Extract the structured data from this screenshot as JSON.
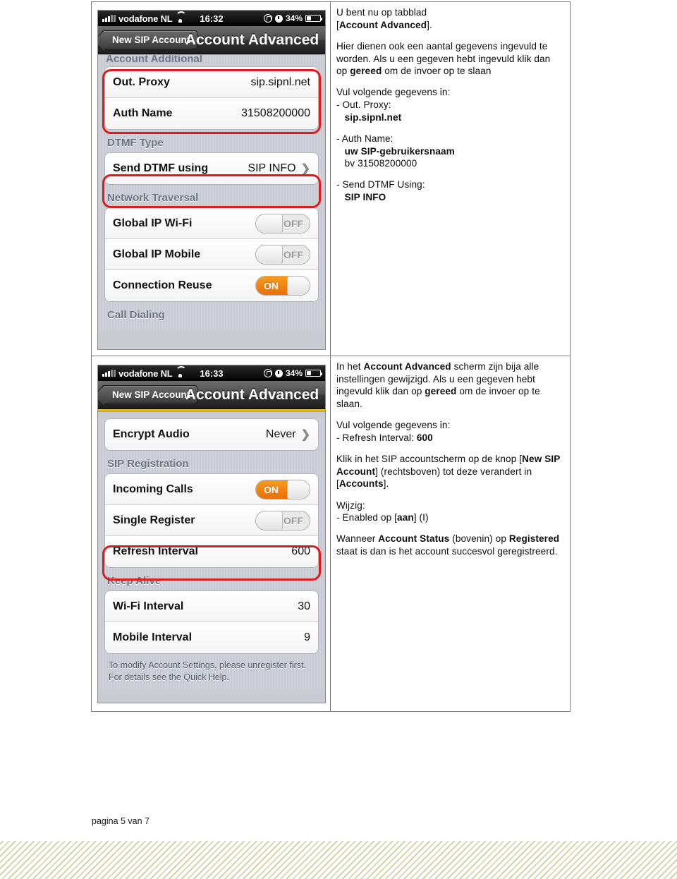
{
  "document": {
    "page_footer": "pagina 5 van 7"
  },
  "rows": [
    {
      "screenshot": {
        "statusbar": {
          "carrier": "vodafone NL",
          "time": "16:32",
          "battery": "34%",
          "signal_icon": "signal-bars-icon",
          "wifi_icon": "wifi-icon",
          "lock_icon": "rotation-lock-icon",
          "alarm_icon": "alarm-clock-icon",
          "battery_icon": "battery-icon"
        },
        "navbar": {
          "back_label": "New SIP Account",
          "title": "Account Advanced"
        },
        "cut_group_header": "Account Additional",
        "groups": [
          {
            "header": "",
            "rows": [
              {
                "label": "Out. Proxy",
                "value": "sip.sipnl.net",
                "type": "value"
              },
              {
                "label": "Auth Name",
                "value": "31508200000",
                "type": "value"
              }
            ]
          },
          {
            "header": "DTMF Type",
            "rows": [
              {
                "label": "Send DTMF using",
                "value": "SIP INFO",
                "type": "disclosure"
              }
            ]
          },
          {
            "header": "Network Traversal",
            "rows": [
              {
                "label": "Global IP Wi-Fi",
                "value": "OFF",
                "type": "switch",
                "state": "off"
              },
              {
                "label": "Global IP Mobile",
                "value": "OFF",
                "type": "switch",
                "state": "off"
              },
              {
                "label": "Connection Reuse",
                "value": "ON",
                "type": "switch",
                "state": "on"
              }
            ]
          },
          {
            "header": "Call Dialing",
            "rows": []
          }
        ]
      },
      "text": {
        "p1_a": "U bent nu op tabblad",
        "p1_b": "[",
        "p1_bold": "Account Advanced",
        "p1_c": "].",
        "p2_a": "Hier dienen ook een aantal gegevens ingevuld te worden. Als u een gegeven hebt ingevuld klik dan op ",
        "p2_bold": "gereed",
        "p2_b": " om de invoer op te slaan",
        "p3": "Vul volgende gegevens in:",
        "item1_label": "-  Out. Proxy:",
        "item1_value": "sip.sipnl.net",
        "item2_label": "-  Auth Name:",
        "item2_value": "uw SIP-gebruikersnaam",
        "item2_extra": "bv 31508200000",
        "item3_label": "-  Send DTMF Using:",
        "item3_value": "SIP INFO"
      }
    },
    {
      "screenshot": {
        "statusbar": {
          "carrier": "vodafone NL",
          "time": "16:33",
          "battery": "34%",
          "signal_icon": "signal-bars-icon",
          "wifi_icon": "wifi-icon",
          "lock_icon": "rotation-lock-icon",
          "alarm_icon": "alarm-clock-icon",
          "battery_icon": "battery-icon"
        },
        "navbar": {
          "back_label": "New SIP Account",
          "title": "Account Advanced"
        },
        "groups": [
          {
            "header": "",
            "rows": [
              {
                "label": "Encrypt Audio",
                "value": "Never",
                "type": "disclosure"
              }
            ]
          },
          {
            "header": "SIP Registration",
            "rows": [
              {
                "label": "Incoming Calls",
                "value": "ON",
                "type": "switch",
                "state": "on"
              },
              {
                "label": "Single Register",
                "value": "OFF",
                "type": "switch",
                "state": "off"
              },
              {
                "label": "Refresh Interval",
                "value": "600",
                "type": "value"
              }
            ]
          },
          {
            "header": "Keep Alive",
            "rows": [
              {
                "label": "Wi-Fi Interval",
                "value": "30",
                "type": "value"
              },
              {
                "label": "Mobile Interval",
                "value": "9",
                "type": "value"
              }
            ]
          }
        ],
        "footnote": "To modify Account Settings, please unregister first.  For details see the Quick Help."
      },
      "text": {
        "p1_a": "In het ",
        "p1_bold1": "Account Advanced",
        "p1_b": " scherm zijn bija alle instellingen gewijzigd. Als u een gegeven hebt ingevuld klik dan op ",
        "p1_bold2": "gereed",
        "p1_c": " om de invoer op te slaan.",
        "p2": "Vul volgende gegevens in:",
        "item1_label": "-  Refresh Interval: ",
        "item1_value": "600",
        "p3_a": "Klik in het SIP accountscherm op de knop [",
        "p3_bold1": "New SIP Account",
        "p3_b": "] (rechtsboven) tot deze verandert in [",
        "p3_bold2": "Accounts",
        "p3_c": "].",
        "p4": "Wijzig:",
        "item2_label": "-   Enabled op [",
        "item2_bold": "aan",
        "item2_tail": "] (I)",
        "p5_a": "Wanneer ",
        "p5_bold1": "Account Status",
        "p5_b": " (bovenin) op ",
        "p5_bold2": "Registered",
        "p5_c": " staat is dan is het account succesvol geregistreerd."
      }
    }
  ],
  "colors": {
    "highlight_red": "#e01b1b",
    "toggle_on_orange": "#e86e09",
    "nav_yellow": "#d4a800",
    "stripe_olive": "#cdcf9e"
  }
}
